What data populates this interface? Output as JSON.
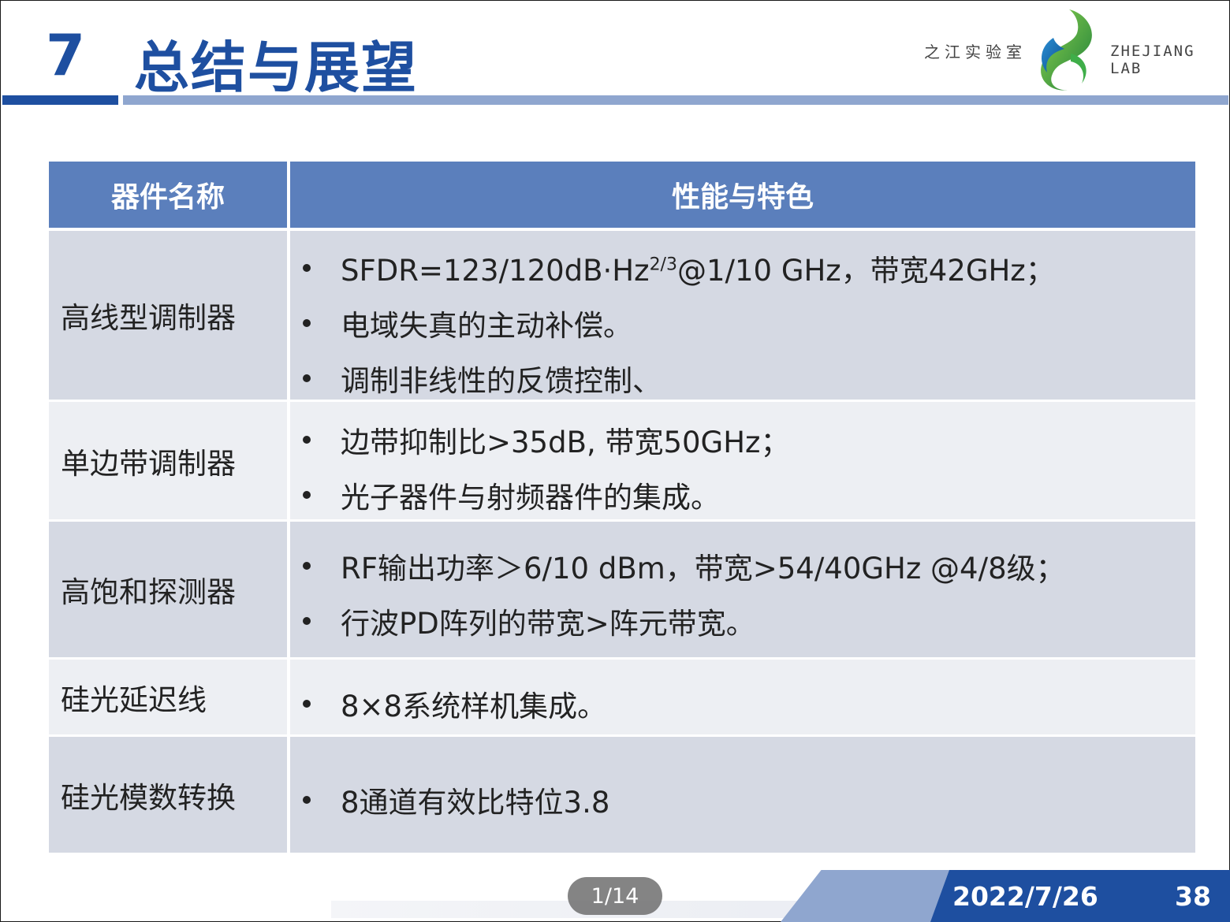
{
  "header": {
    "section_number": "7",
    "title": "总结与展望",
    "org_name_cn": "之江实验室",
    "org_name_en": "ZHEJIANG LAB"
  },
  "table": {
    "columns": [
      "器件名称",
      "性能与特色"
    ],
    "rows": [
      {
        "name": "高线型调制器",
        "features": [
          {
            "pre": "SFDR=123/120dB·Hz",
            "sup": "2/3",
            "post": "@1/10 GHz，带宽42GHz；"
          },
          {
            "pre": "电域失真的主动补偿。",
            "sup": "",
            "post": ""
          },
          {
            "pre": "调制非线性的反馈控制、",
            "sup": "",
            "post": ""
          }
        ]
      },
      {
        "name": "单边带调制器",
        "features": [
          {
            "pre": "边带抑制比>35dB, 带宽50GHz；",
            "sup": "",
            "post": ""
          },
          {
            "pre": "光子器件与射频器件的集成。",
            "sup": "",
            "post": ""
          }
        ]
      },
      {
        "name": "高饱和探测器",
        "features": [
          {
            "pre": "RF输出功率＞6/10 dBm，带宽>54/40GHz @4/8级；",
            "sup": "",
            "post": ""
          },
          {
            "pre": "行波PD阵列的带宽>阵元带宽。",
            "sup": "",
            "post": ""
          }
        ]
      },
      {
        "name": "硅光延迟线",
        "features": [
          {
            "pre": "8×8系统样机集成。",
            "sup": "",
            "post": ""
          }
        ]
      },
      {
        "name": "硅光模数转换",
        "features": [
          {
            "pre": "8通道有效比特位3.8",
            "sup": "",
            "post": ""
          }
        ]
      }
    ]
  },
  "footer": {
    "date": "2022/7/26",
    "page_number": "38"
  },
  "viewer": {
    "pager": "1/14"
  },
  "colors": {
    "brand_blue": "#1e4fa0",
    "header_blue": "#5b7fbc",
    "light_blue": "#8fa6cf",
    "row_odd": "#d5d9e3",
    "row_even": "#edeff3"
  }
}
